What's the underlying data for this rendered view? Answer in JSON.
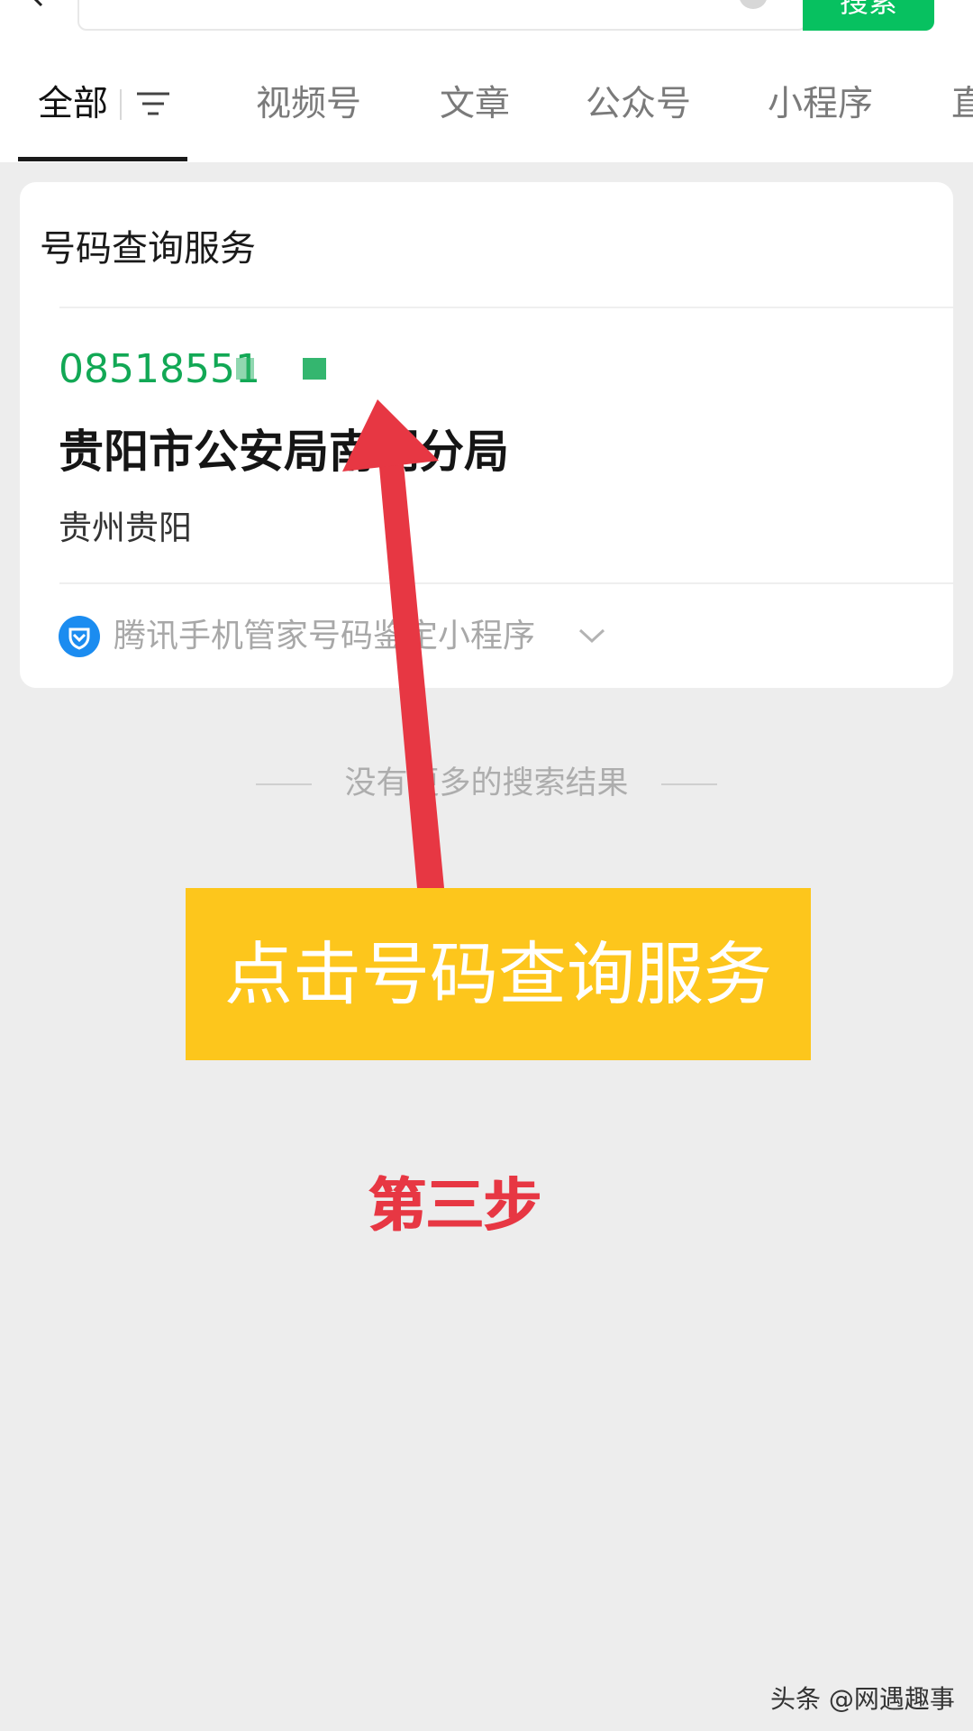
{
  "search_bar": {
    "search_button_label": "搜索"
  },
  "tabs": [
    {
      "label": "全部",
      "active": true
    },
    {
      "label": "视频号",
      "active": false
    },
    {
      "label": "文章",
      "active": false
    },
    {
      "label": "公众号",
      "active": false
    },
    {
      "label": "小程序",
      "active": false
    },
    {
      "label": "直",
      "active": false
    }
  ],
  "result_card": {
    "title": "号码查询服务",
    "phone_number": "08518551",
    "agency_name": "贵阳市公安局南明分局",
    "location": "贵州贵阳",
    "provider": "腾讯手机管家号码鉴定小程序"
  },
  "no_more_results": "没有更多的搜索结果",
  "annotation": {
    "callout": "点击号码查询服务",
    "step": "第三步"
  },
  "watermark": "头条 @网遇趣事",
  "colors": {
    "brand_green": "#07c160",
    "phone_green": "#12a855",
    "callout_yellow": "#fdc61c",
    "arrow_red": "#e73743"
  }
}
